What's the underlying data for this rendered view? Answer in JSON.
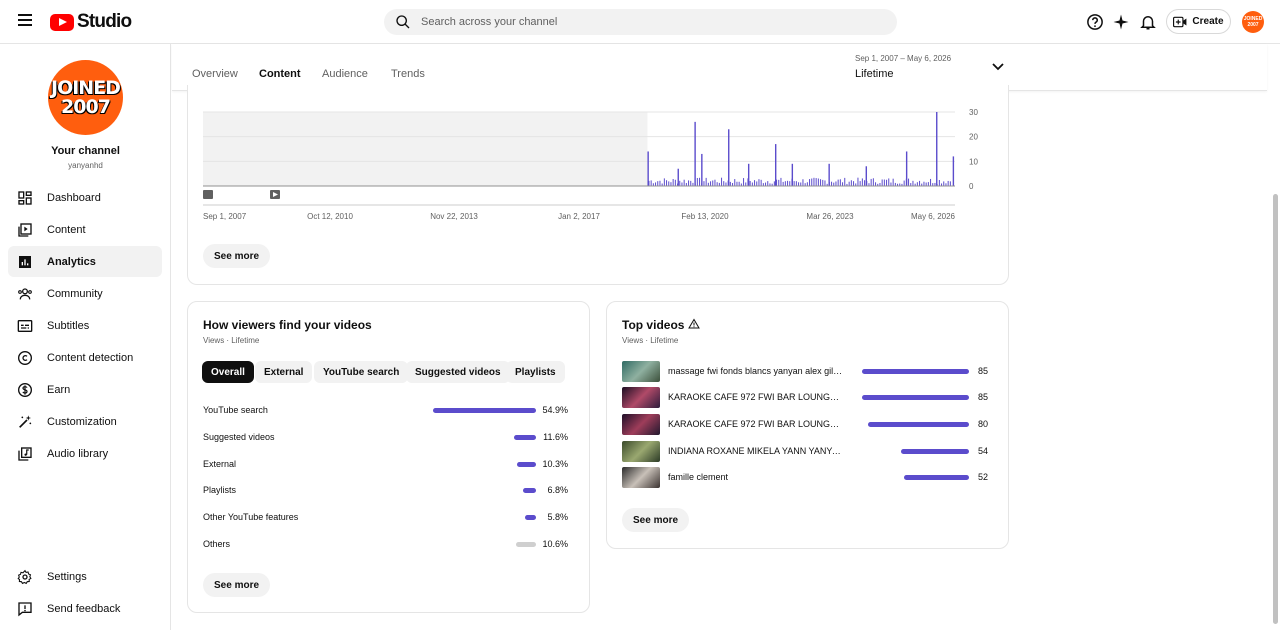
{
  "app": {
    "logo_text": "Studio"
  },
  "search": {
    "placeholder": "Search across your channel"
  },
  "header": {
    "create_label": "Create",
    "avatar_text": "JOINED 2007"
  },
  "channel": {
    "avatar_line1": "JOINED",
    "avatar_line2": "2007",
    "name": "Your channel",
    "handle": "yanyanhd"
  },
  "sidebar": {
    "items": [
      {
        "label": "Dashboard",
        "icon": "dashboard-icon"
      },
      {
        "label": "Content",
        "icon": "content-icon"
      },
      {
        "label": "Analytics",
        "icon": "analytics-icon",
        "active": true
      },
      {
        "label": "Community",
        "icon": "community-icon"
      },
      {
        "label": "Subtitles",
        "icon": "subtitles-icon"
      },
      {
        "label": "Content detection",
        "icon": "copyright-icon"
      },
      {
        "label": "Earn",
        "icon": "dollar-icon"
      },
      {
        "label": "Customization",
        "icon": "magic-wand-icon"
      },
      {
        "label": "Audio library",
        "icon": "audio-library-icon"
      }
    ],
    "footer": [
      {
        "label": "Settings",
        "icon": "gear-icon"
      },
      {
        "label": "Send feedback",
        "icon": "feedback-icon"
      }
    ]
  },
  "tabs": [
    {
      "label": "Overview"
    },
    {
      "label": "Content",
      "active": true
    },
    {
      "label": "Audience"
    },
    {
      "label": "Trends"
    }
  ],
  "date_range": {
    "range": "Sep 1, 2007 – May 6, 2026",
    "label": "Lifetime"
  },
  "chart_data": {
    "type": "bar",
    "x_ticks": [
      "Sep 1, 2007",
      "Oct 12, 2010",
      "Nov 22, 2013",
      "Jan 2, 2017",
      "Feb 13, 2020",
      "Mar 26, 2023",
      "May 6, 2026"
    ],
    "y_ticks": [
      "30",
      "20",
      "10",
      "0"
    ],
    "ylim": [
      0,
      30
    ],
    "series_color": "#5b4ccc",
    "shaded_region_end": "2018-09",
    "peaks": [
      {
        "x": "2018-09",
        "y": 14
      },
      {
        "x": "2019-06",
        "y": 7
      },
      {
        "x": "2019-11",
        "y": 26
      },
      {
        "x": "2020-01",
        "y": 13
      },
      {
        "x": "2020-09",
        "y": 23
      },
      {
        "x": "2021-03",
        "y": 9
      },
      {
        "x": "2021-11",
        "y": 17
      },
      {
        "x": "2022-04",
        "y": 9
      },
      {
        "x": "2023-03",
        "y": 9
      },
      {
        "x": "2024-02",
        "y": 8
      },
      {
        "x": "2025-02",
        "y": 14
      },
      {
        "x": "2025-11",
        "y": 30
      },
      {
        "x": "2026-04",
        "y": 12
      }
    ],
    "see_more": "See more"
  },
  "traffic": {
    "title": "How viewers find your videos",
    "subtitle": "Views · Lifetime",
    "chips": [
      {
        "label": "Overall",
        "active": true
      },
      {
        "label": "External"
      },
      {
        "label": "YouTube search"
      },
      {
        "label": "Suggested videos"
      },
      {
        "label": "Playlists"
      }
    ],
    "rows": [
      {
        "label": "YouTube search",
        "value": "54.9%",
        "pct": 54.9,
        "color": "#5b4ccc"
      },
      {
        "label": "Suggested videos",
        "value": "11.6%",
        "pct": 11.6,
        "color": "#5b4ccc"
      },
      {
        "label": "External",
        "value": "10.3%",
        "pct": 10.3,
        "color": "#5b4ccc"
      },
      {
        "label": "Playlists",
        "value": "6.8%",
        "pct": 6.8,
        "color": "#5b4ccc"
      },
      {
        "label": "Other YouTube features",
        "value": "5.8%",
        "pct": 5.8,
        "color": "#5b4ccc"
      },
      {
        "label": "Others",
        "value": "10.6%",
        "pct": 10.6,
        "color": "#cfcfcf"
      }
    ],
    "see_more": "See more"
  },
  "top_videos": {
    "title": "Top videos",
    "subtitle": "Views · Lifetime",
    "rows": [
      {
        "title": "massage fwi fonds blancs yanyan alex gille...",
        "views": "85",
        "value": 85
      },
      {
        "title": "KARAOKE CAFE 972 FWI BAR LOUNGE DA...",
        "views": "85",
        "value": 85
      },
      {
        "title": "KARAOKE CAFE 972 FWI BAR LOUNGE DA...",
        "views": "80",
        "value": 80
      },
      {
        "title": "INDIANA ROXANE MIKELA YANN YANYAN ...",
        "views": "54",
        "value": 54
      },
      {
        "title": "famille clement",
        "views": "52",
        "value": 52
      }
    ],
    "see_more": "See more"
  }
}
